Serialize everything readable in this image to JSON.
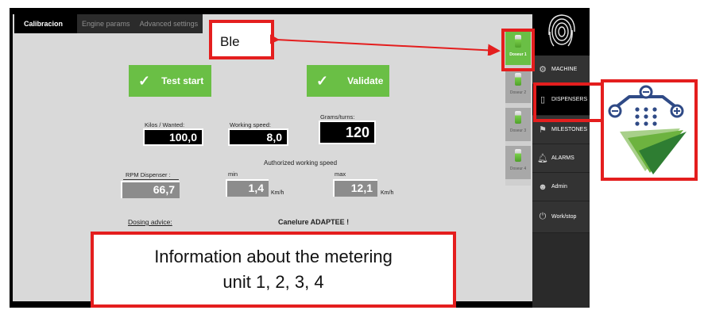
{
  "tabs": [
    {
      "label": "Calibracion"
    },
    {
      "label": "Engine params"
    },
    {
      "label": "Advanced settings"
    }
  ],
  "buttons": {
    "test_start": "Test start",
    "validate": "Validate"
  },
  "fields": {
    "kilos_label": "Kilos / Wanted:",
    "kilos_value": "100,0",
    "working_speed_label": "Working speed:",
    "working_speed_value": "8,0",
    "grams_label": "Grams/turns:",
    "grams_value": "120",
    "authorized_title": "Authorized working speed",
    "rpm_label": "RPM Dispenser :",
    "rpm_value": "66,7",
    "min_label": "min",
    "min_value": "1,4",
    "max_label": "max",
    "max_value": "12,1",
    "unit": "Km/h",
    "dosing_label": "Dosing advice:",
    "dosing_value": "Canelure ADAPTEE !"
  },
  "dosers": [
    {
      "label": "Doseur 1",
      "active": true
    },
    {
      "label": "Doseur 2",
      "active": false
    },
    {
      "label": "Doseur 3",
      "active": false
    },
    {
      "label": "Doseur 4",
      "active": false
    }
  ],
  "sidebar": {
    "items": [
      {
        "label": "MACHINE",
        "icon": "gear-icon"
      },
      {
        "label": "DISPENSERS",
        "icon": "dispenser-icon"
      },
      {
        "label": "MILESTONES",
        "icon": "flags-icon"
      },
      {
        "label": "ALARMS",
        "icon": "bell-icon"
      },
      {
        "label": "Admin",
        "icon": "user-icon"
      },
      {
        "label": "Work/stop",
        "icon": "power-icon"
      }
    ]
  },
  "annotations": {
    "ble_label": "Ble",
    "info_text": "Information about the metering unit 1, 2, 3, 4"
  },
  "colors": {
    "accent_green": "#6abf45",
    "annotation_red": "#e41e1e",
    "logo_blue": "#2f4a86"
  }
}
